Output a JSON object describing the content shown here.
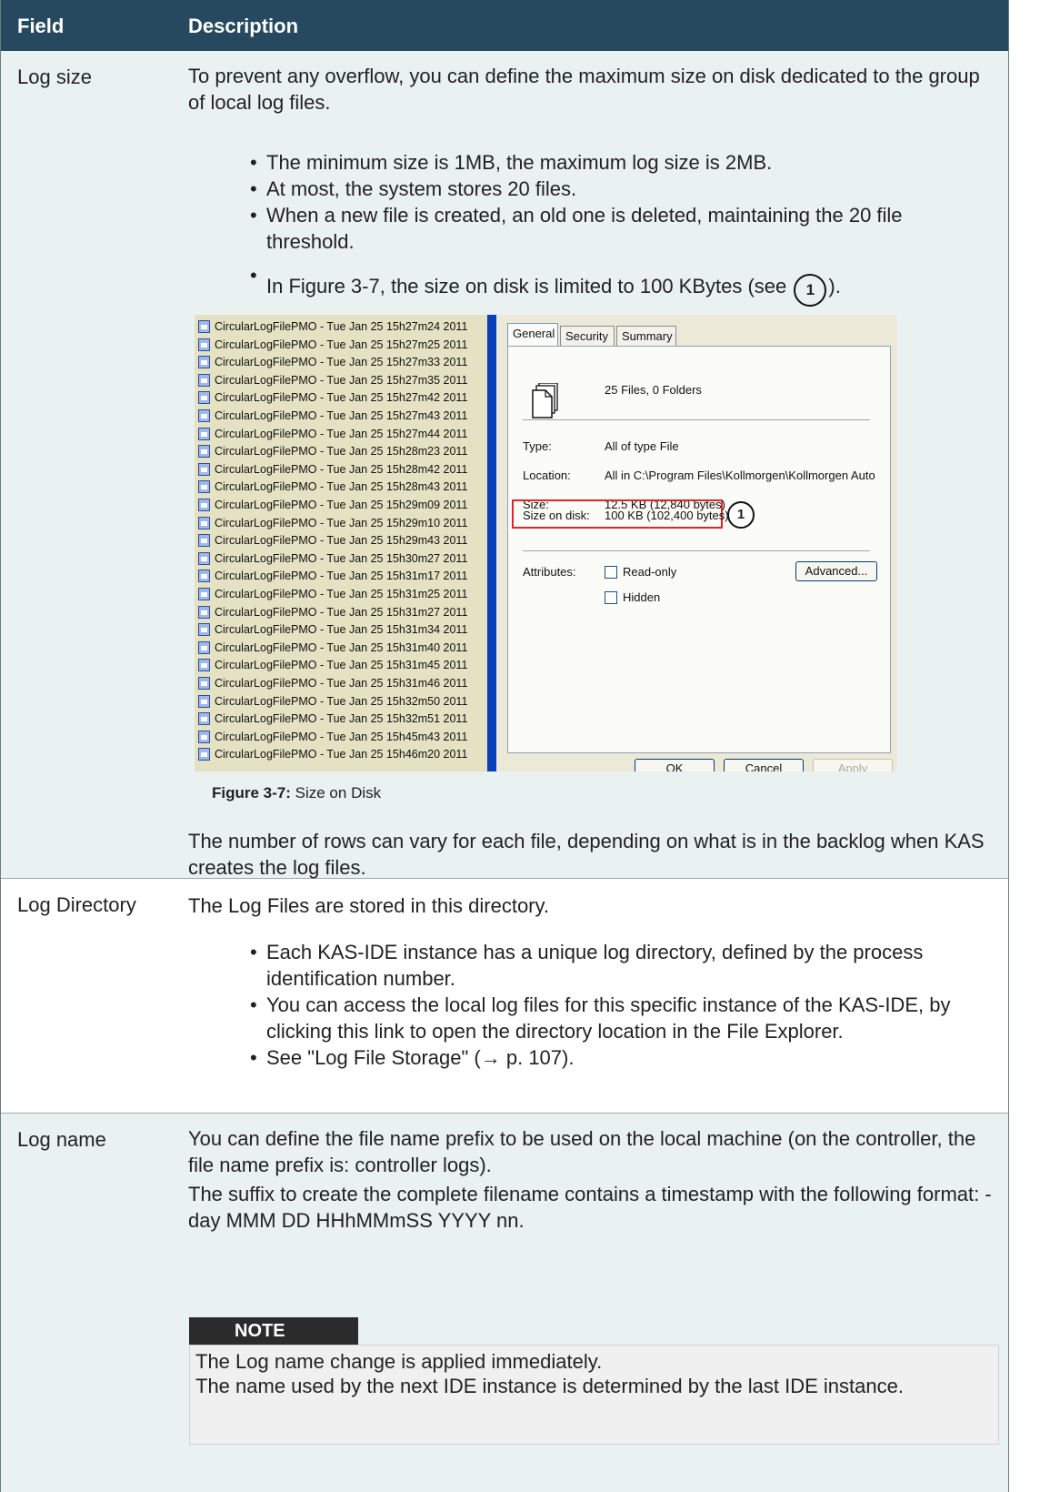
{
  "header": {
    "field": "Field",
    "description": "Description"
  },
  "log_size": {
    "field": "Log size",
    "intro": "To prevent any overflow, you can define the maximum size on disk dedicated to the group of local log files.",
    "bullets": [
      "The minimum size is 1MB, the maximum log size is 2MB.",
      "At most, the system stores 20 files.",
      "When a new file is created, an old one is deleted, maintaining the 20 file threshold."
    ],
    "figure_ref_pre": "In Figure 3-7, the size on disk is limited to 100 KBytes (see",
    "figure_ref_marker": "1",
    "figure_ref_post": ").",
    "files": [
      "CircularLogFilePMO - Tue Jan 25 15h27m24 2011",
      "CircularLogFilePMO - Tue Jan 25 15h27m25 2011",
      "CircularLogFilePMO - Tue Jan 25 15h27m33 2011",
      "CircularLogFilePMO - Tue Jan 25 15h27m35 2011",
      "CircularLogFilePMO - Tue Jan 25 15h27m42 2011",
      "CircularLogFilePMO - Tue Jan 25 15h27m43 2011",
      "CircularLogFilePMO - Tue Jan 25 15h27m44 2011",
      "CircularLogFilePMO - Tue Jan 25 15h28m23 2011",
      "CircularLogFilePMO - Tue Jan 25 15h28m42 2011",
      "CircularLogFilePMO - Tue Jan 25 15h28m43 2011",
      "CircularLogFilePMO - Tue Jan 25 15h29m09 2011",
      "CircularLogFilePMO - Tue Jan 25 15h29m10 2011",
      "CircularLogFilePMO - Tue Jan 25 15h29m43 2011",
      "CircularLogFilePMO - Tue Jan 25 15h30m27 2011",
      "CircularLogFilePMO - Tue Jan 25 15h31m17 2011",
      "CircularLogFilePMO - Tue Jan 25 15h31m25 2011",
      "CircularLogFilePMO - Tue Jan 25 15h31m27 2011",
      "CircularLogFilePMO - Tue Jan 25 15h31m34 2011",
      "CircularLogFilePMO - Tue Jan 25 15h31m40 2011",
      "CircularLogFilePMO - Tue Jan 25 15h31m45 2011",
      "CircularLogFilePMO - Tue Jan 25 15h31m46 2011",
      "CircularLogFilePMO - Tue Jan 25 15h32m50 2011",
      "CircularLogFilePMO - Tue Jan 25 15h32m51 2011",
      "CircularLogFilePMO - Tue Jan 25 15h45m43 2011",
      "CircularLogFilePMO - Tue Jan 25 15h46m20 2011"
    ],
    "dialog": {
      "tabs": [
        "General",
        "Security",
        "Summary"
      ],
      "summary": "25 Files, 0 Folders",
      "type_label": "Type:",
      "type_value": "All of type File",
      "location_label": "Location:",
      "location_value": "All in C:\\Program Files\\Kollmorgen\\Kollmorgen Auto",
      "size_label": "Size:",
      "size_value": "12.5 KB (12,840 bytes)",
      "size_on_disk_label": "Size on disk:",
      "size_on_disk_value": "100 KB (102,400 bytes)",
      "marker": "1",
      "attributes_label": "Attributes:",
      "readonly_label": "Read-only",
      "hidden_label": "Hidden",
      "advanced_button": "Advanced...",
      "ok_button": "OK",
      "cancel_button": "Cancel",
      "apply_button": "Apply"
    },
    "caption_label": "Figure 3-7:",
    "caption_text": "Size on Disk",
    "outro": "The number of rows can vary for each file, depending on what is in the backlog when KAS creates the log files."
  },
  "log_directory": {
    "field": "Log Directory",
    "intro": "The Log Files are stored in this directory.",
    "bullets": [
      "Each KAS-IDE instance has a unique log directory, defined by the process identification number.",
      "You can access the local log files for this specific instance of the KAS-IDE, by clicking this link to open the directory location in the File Explorer.",
      "See \"Log File Storage\" (→ p. 107)."
    ]
  },
  "log_name": {
    "field": "Log name",
    "p1": "You can define the file name prefix to be used on the local machine (on the controller, the file name prefix is: controller logs).",
    "p2": "The suffix to create the complete filename contains a timestamp with the following format: - day MMM DD HHhMMmSS YYYY nn.",
    "note_label": "NOTE",
    "note_line1": "The Log name change is applied immediately.",
    "note_line2": "The name used by the next IDE instance is determined by the last IDE instance."
  }
}
